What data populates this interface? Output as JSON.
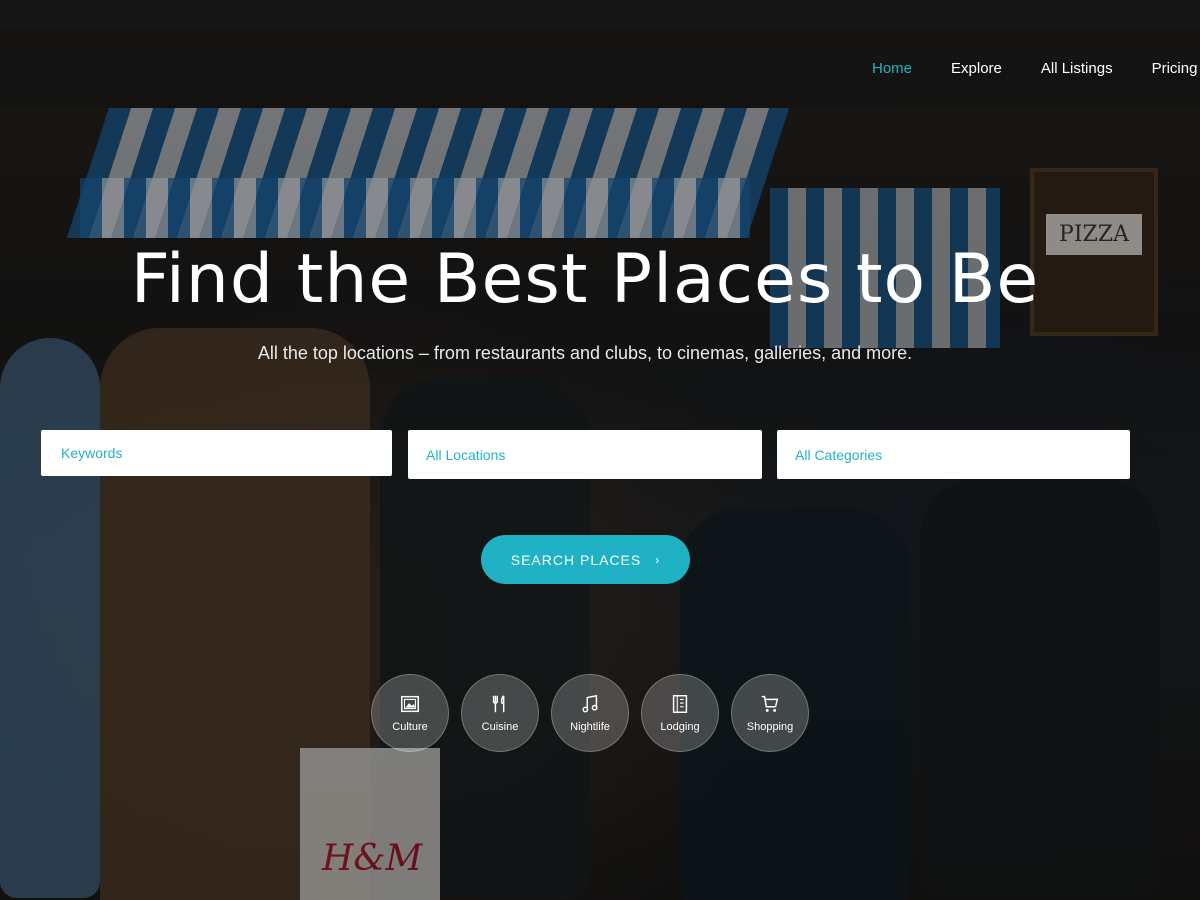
{
  "nav": {
    "items": [
      {
        "label": "Home",
        "active": true
      },
      {
        "label": "Explore",
        "active": false
      },
      {
        "label": "All Listings",
        "active": false
      },
      {
        "label": "Pricing",
        "active": false
      }
    ]
  },
  "hero": {
    "title": "Find the Best Places to Be",
    "subtitle": "All the top locations – from restaurants and clubs, to cinemas, galleries, and more.",
    "scene_sign_text": "PIZZA",
    "scene_bag_text": "H&M"
  },
  "search": {
    "keywords_placeholder": "Keywords",
    "location_value": "All Locations",
    "category_value": "All Categories",
    "button_label": "SEARCH PLACES",
    "button_icon": "chevron-right-icon"
  },
  "categories": [
    {
      "label": "Culture",
      "icon": "image-icon"
    },
    {
      "label": "Cuisine",
      "icon": "utensils-icon"
    },
    {
      "label": "Nightlife",
      "icon": "music-note-icon"
    },
    {
      "label": "Lodging",
      "icon": "building-icon"
    },
    {
      "label": "Shopping",
      "icon": "cart-icon"
    }
  ],
  "colors": {
    "accent": "#1fb2c4",
    "nav_active": "#22b3c6",
    "topbar": "#161616"
  }
}
